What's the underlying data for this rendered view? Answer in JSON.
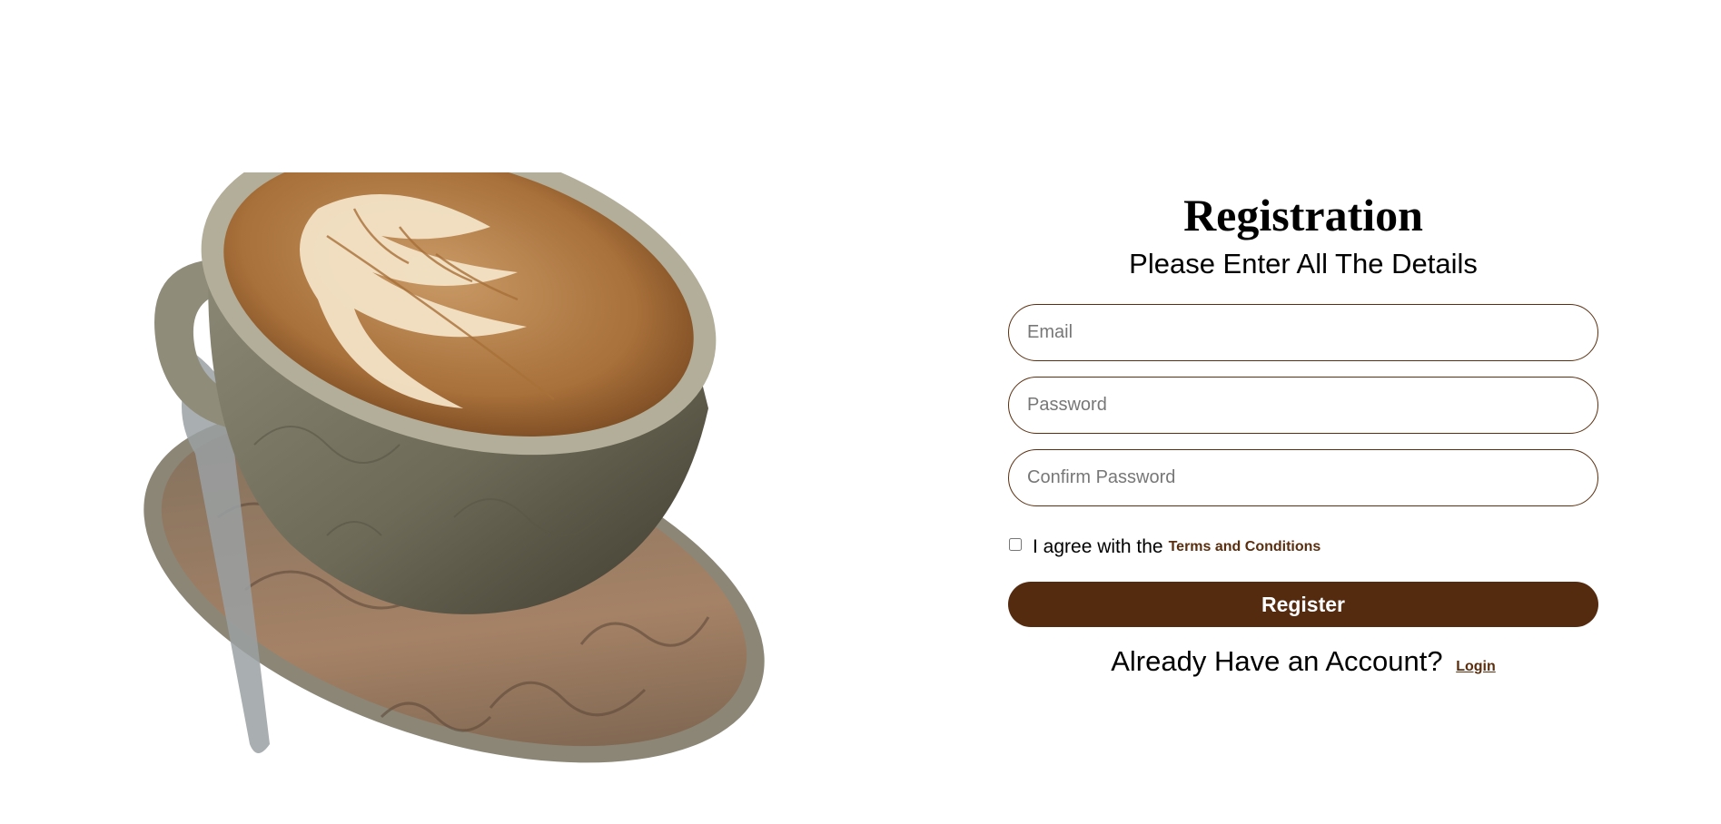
{
  "colors": {
    "accent": "#552b10",
    "border": "#5a2e0e",
    "background": "#ffffff"
  },
  "hero": {
    "icon": "latte-cup-illustration"
  },
  "form": {
    "title": "Registration",
    "subtitle": "Please Enter All The Details",
    "email_placeholder": "Email",
    "password_placeholder": "Password",
    "confirm_password_placeholder": "Confirm Password",
    "agree_text": "I agree with the",
    "terms_link": "Terms and Conditions",
    "register_label": "Register",
    "login_prompt": "Already Have an Account?",
    "login_link": "Login"
  }
}
